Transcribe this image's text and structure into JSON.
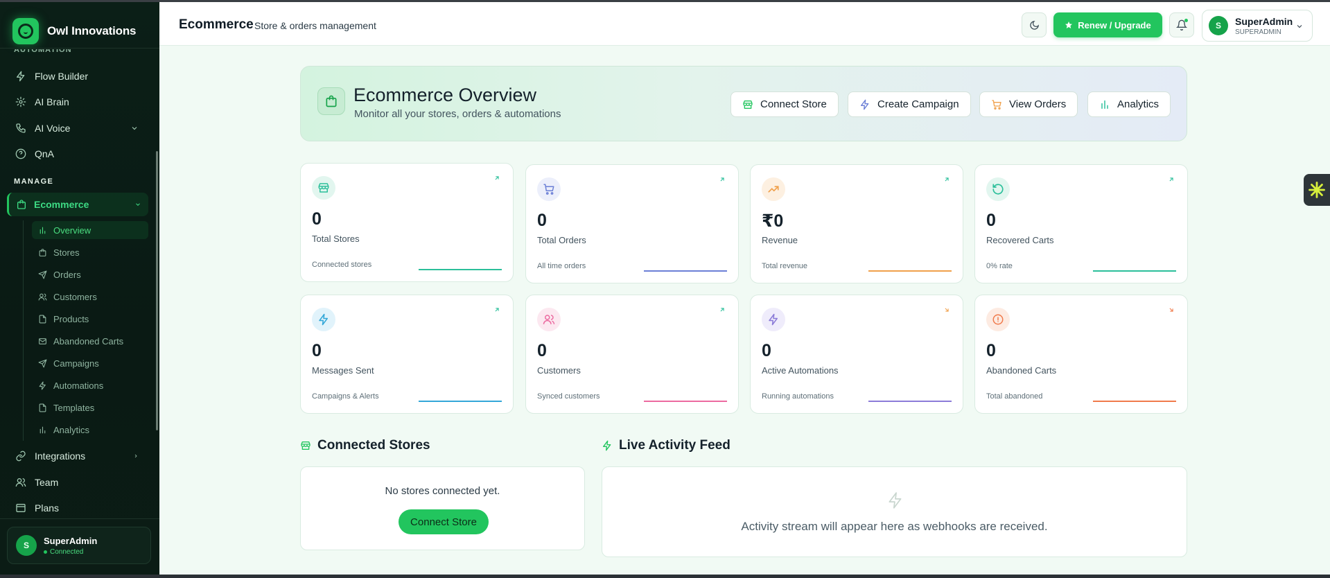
{
  "colors": {
    "accent": "#22c55e",
    "sidebar_bg": "#0b1f17",
    "page_bg": "#f1faf4"
  },
  "brand": {
    "name": "Owl Innovations",
    "icon": "owl-logo-icon"
  },
  "sidebar": {
    "cut_section": "AUTOMATION",
    "top_items": [
      {
        "label": "Flow Builder",
        "icon": "bolt-icon"
      },
      {
        "label": "AI Brain",
        "icon": "sparkle-icon"
      },
      {
        "label": "AI Voice",
        "icon": "phone-icon"
      },
      {
        "label": "QnA",
        "icon": "help-circle-icon"
      }
    ],
    "manage_section": "MANAGE",
    "active_item": {
      "label": "Ecommerce",
      "icon": "shopping-bag-icon"
    },
    "sub_items": [
      {
        "label": "Overview",
        "icon": "bar-chart-icon"
      },
      {
        "label": "Stores",
        "icon": "bag-icon"
      },
      {
        "label": "Orders",
        "icon": "send-icon"
      },
      {
        "label": "Customers",
        "icon": "users-icon"
      },
      {
        "label": "Products",
        "icon": "file-icon"
      },
      {
        "label": "Abandoned Carts",
        "icon": "mail-icon"
      },
      {
        "label": "Campaigns",
        "icon": "send-icon"
      },
      {
        "label": "Automations",
        "icon": "bolt-icon"
      },
      {
        "label": "Templates",
        "icon": "file-icon"
      },
      {
        "label": "Analytics",
        "icon": "bar-chart-icon"
      }
    ],
    "bottom_items": [
      {
        "label": "Integrations",
        "icon": "link-icon"
      },
      {
        "label": "Team",
        "icon": "users-icon"
      },
      {
        "label": "Plans",
        "icon": "plans-icon"
      }
    ],
    "user": {
      "initial": "S",
      "name": "SuperAdmin",
      "status": "Connected"
    }
  },
  "header": {
    "title": "Ecommerce",
    "subtitle": "Store & orders management",
    "renew_label": "Renew / Upgrade",
    "user_initial": "S",
    "user_name": "SuperAdmin",
    "user_role": "SUPERADMIN"
  },
  "banner": {
    "title": "Ecommerce Overview",
    "subtitle": "Monitor all your stores, orders & automations",
    "buttons": [
      {
        "label": "Connect Store",
        "icon": "store-icon"
      },
      {
        "label": "Create Campaign",
        "icon": "bolt-icon"
      },
      {
        "label": "View Orders",
        "icon": "cart-icon"
      },
      {
        "label": "Analytics",
        "icon": "bar-chart-icon"
      }
    ]
  },
  "stats": [
    {
      "value": "0",
      "label": "Total Stores",
      "note": "Connected stores",
      "color": "#2bbf9a",
      "icon": "store-icon"
    },
    {
      "value": "0",
      "label": "Total Orders",
      "note": "All time orders",
      "color": "#6b7fd6",
      "icon": "cart-icon"
    },
    {
      "value": "₹0",
      "label": "Revenue",
      "note": "Total revenue",
      "color": "#f0a04b",
      "icon": "trending-up-icon"
    },
    {
      "value": "0",
      "label": "Recovered Carts",
      "note": "0% rate",
      "color": "#2bbf9a",
      "icon": "refresh-icon"
    },
    {
      "value": "0",
      "label": "Messages Sent",
      "note": "Campaigns & Alerts",
      "color": "#33a7d8",
      "icon": "bolt-icon"
    },
    {
      "value": "0",
      "label": "Customers",
      "note": "Synced customers",
      "color": "#ec6aa0",
      "icon": "users-icon"
    },
    {
      "value": "0",
      "label": "Active Automations",
      "note": "Running automations",
      "color": "#8b7bd8",
      "icon": "bolt-icon"
    },
    {
      "value": "0",
      "label": "Abandoned Carts",
      "note": "Total abandoned",
      "color": "#f07a4b",
      "icon": "alert-circle-icon"
    }
  ],
  "connected_stores": {
    "title": "Connected Stores",
    "empty_message": "No stores connected yet.",
    "button_label": "Connect Store"
  },
  "activity_feed": {
    "title": "Live Activity Feed",
    "empty_message": "Activity stream will appear here as webhooks are received."
  }
}
